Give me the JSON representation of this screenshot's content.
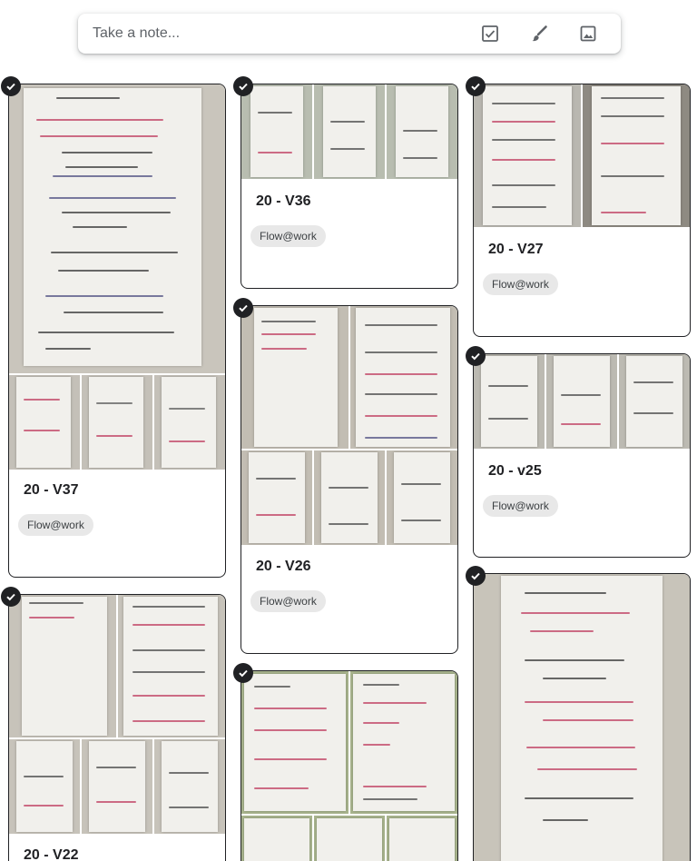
{
  "note_bar": {
    "placeholder": "Take a note...",
    "icons": [
      "checkbox-icon",
      "brush-icon",
      "image-icon"
    ]
  },
  "notes": [
    {
      "title": "20 - V37",
      "label": "Flow@work"
    },
    {
      "title": "20 - V36",
      "label": "Flow@work"
    },
    {
      "title": "20 - V27",
      "label": "Flow@work"
    },
    {
      "title": "20 - V26",
      "label": "Flow@work"
    },
    {
      "title": "20 - v25",
      "label": "Flow@work"
    },
    {
      "title": "20 - V22"
    }
  ],
  "handwriting": {
    "v37_main": [
      "Calm: 5/5",
      "I'm doing my optimal day setup - the best conditions I can than let magic happen.",
      "Location reset",
      "Conference room focus - close door when need to focus.",
      "How does motivation and location relate?",
      "I'm trusting my feel 4 scheduling - I know what I'll need 2 do and when."
    ],
    "engagement_photo": [
      "Engagement: 5/5",
      "Reset content after interrupt",
      "Where do I take it now?",
      "I am in my safe zone too much.",
      "Where can I find Kairos goals?",
      "What's my first move?"
    ]
  }
}
